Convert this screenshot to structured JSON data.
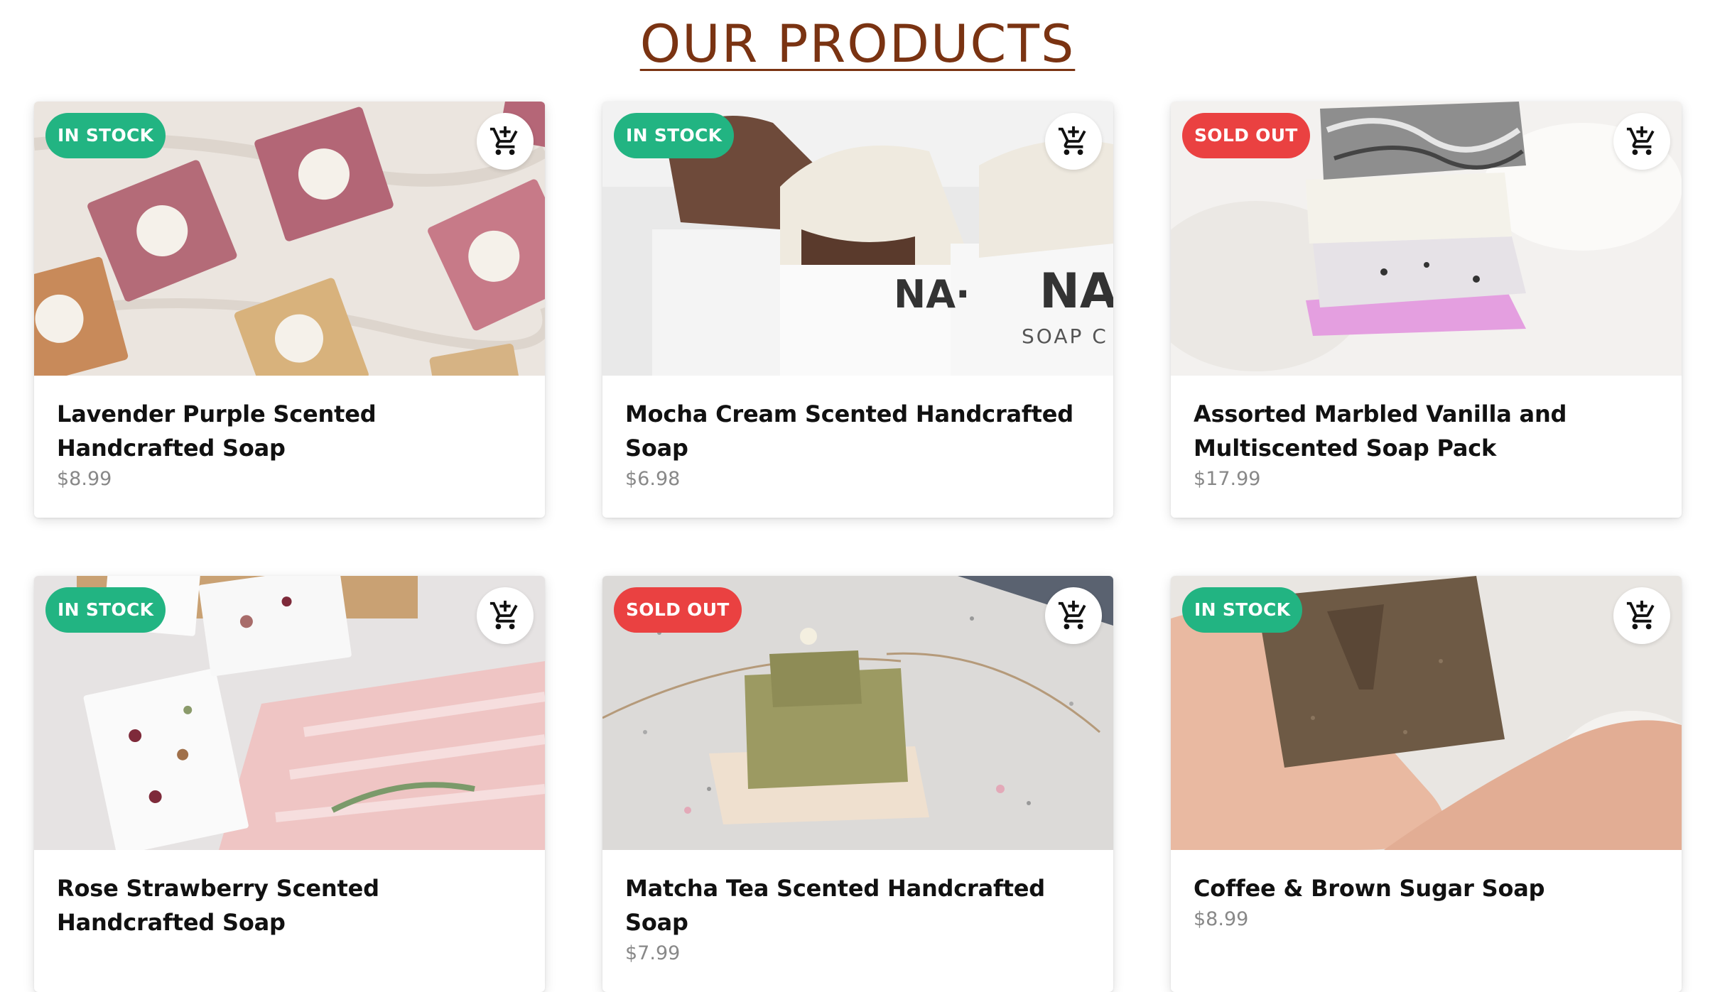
{
  "page": {
    "title": "OUR PRODUCTS"
  },
  "cart_icon": "add-shopping-cart-icon",
  "colors": {
    "title": "#7a3312",
    "in_stock": "#22b482",
    "sold_out": "#ea4141",
    "price": "#888888"
  },
  "products": [
    {
      "name": "Lavender Purple Scented Handcrafted Soap",
      "price": "$8.99",
      "status": "IN STOCK",
      "image": "lavender-soap-photo"
    },
    {
      "name": "Mocha Cream Scented Handcrafted Soap",
      "price": "$6.98",
      "status": "IN STOCK",
      "image": "mocha-soap-photo"
    },
    {
      "name": "Assorted Marbled Vanilla and Multiscented Soap Pack",
      "price": "$17.99",
      "status": "SOLD OUT",
      "image": "marbled-soap-stack-photo"
    },
    {
      "name": "Rose Strawberry Scented Handcrafted Soap",
      "price": "",
      "status": "IN STOCK",
      "image": "rose-soap-photo"
    },
    {
      "name": "Matcha Tea Scented Handcrafted Soap",
      "price": "$7.99",
      "status": "SOLD OUT",
      "image": "matcha-soap-photo"
    },
    {
      "name": "Coffee & Brown Sugar Soap",
      "price": "$8.99",
      "status": "IN STOCK",
      "image": "coffee-soap-photo"
    }
  ]
}
